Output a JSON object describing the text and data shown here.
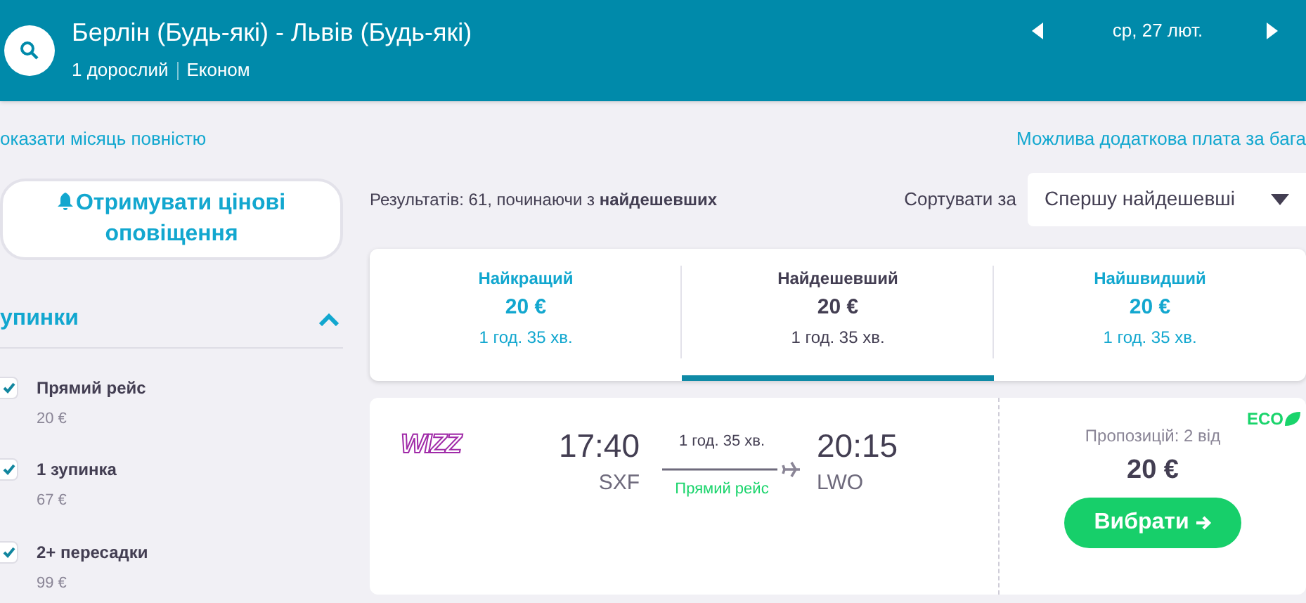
{
  "header": {
    "route": "Берлін (Будь-які) - Львів (Будь-які)",
    "passengers": "1 дорослий",
    "cabin": "Економ",
    "date": "ср, 27 лют."
  },
  "links": {
    "month": "оказати місяць повністю",
    "baggage": "Можлива додаткова плата за бага"
  },
  "alert_button": "Отримувати цінові оповіщення",
  "filter": {
    "title": "упинки",
    "expanded": true,
    "options": [
      {
        "label": "Прямий рейс",
        "price": "20 €",
        "checked": true
      },
      {
        "label": "1 зупинка",
        "price": "67 €",
        "checked": true
      },
      {
        "label": "2+ пересадки",
        "price": "99 €",
        "checked": true
      }
    ]
  },
  "results": {
    "summary": "Результатів: 61, починаючи з **найдешевших**",
    "sort_label": "Сортувати за",
    "sort_value": "Спершу найдешевші"
  },
  "tabs": [
    {
      "title": "Найкращий",
      "price": "20 €",
      "duration": "1 год. 35 хв.",
      "selected": false
    },
    {
      "title": "Найдешевший",
      "price": "20 €",
      "duration": "1 год. 35 хв.",
      "selected": true
    },
    {
      "title": "Найшвидший",
      "price": "20 €",
      "duration": "1 год. 35 хв.",
      "selected": false
    }
  ],
  "flight": {
    "airline": "WIZZ",
    "depart_time": "17:40",
    "depart_airport": "SXF",
    "duration": "1 год. 35 хв.",
    "stops": "Прямий рейс",
    "arrive_time": "20:15",
    "arrive_airport": "LWO",
    "eco": "ECO",
    "offers": "Пропозицій: 2 від",
    "price": "20 €",
    "button": "Вибрати"
  }
}
